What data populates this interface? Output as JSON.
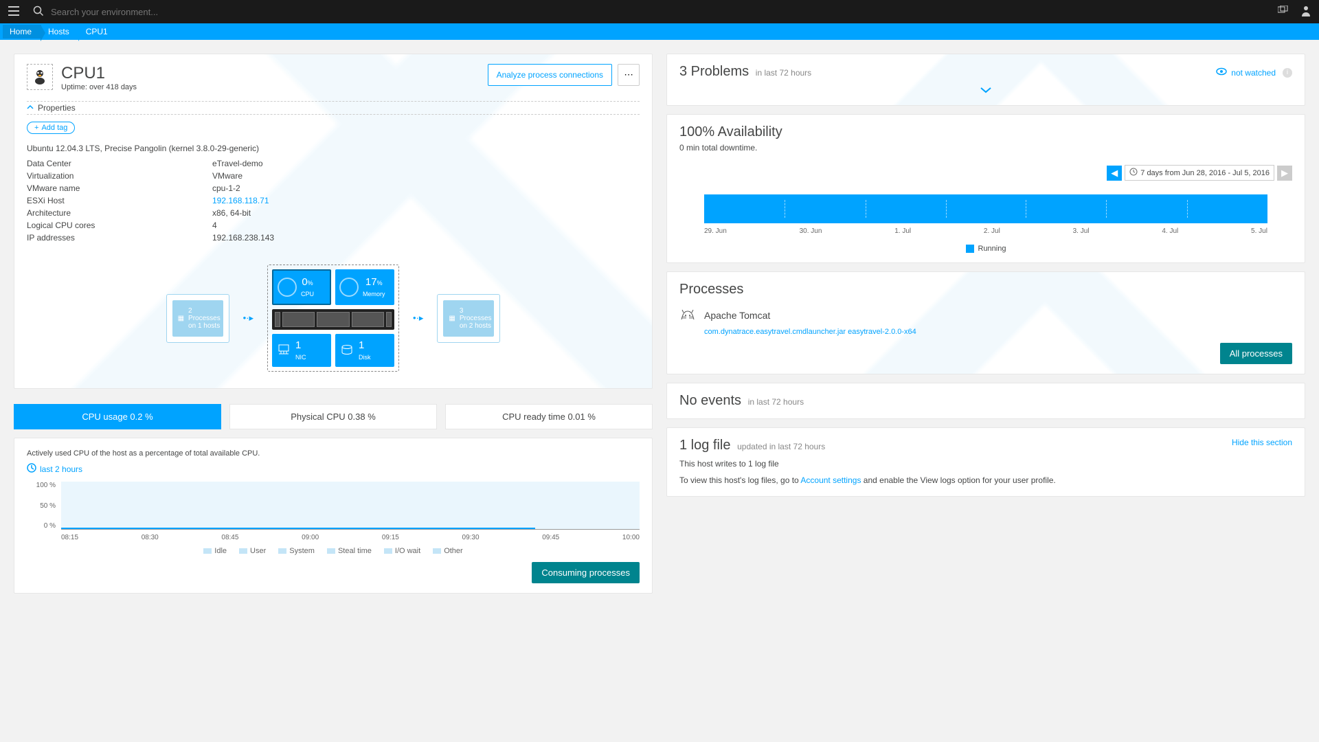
{
  "topbar": {
    "search_placeholder": "Search your environment..."
  },
  "breadcrumb": [
    "Home",
    "Hosts",
    "CPU1"
  ],
  "host": {
    "title": "CPU1",
    "uptime": "Uptime: over 418 days",
    "analyze_btn": "Analyze process connections",
    "properties_label": "Properties",
    "add_tag": "Add tag",
    "os": "Ubuntu 12.04.3 LTS, Precise Pangolin (kernel 3.8.0-29-generic)",
    "kv": [
      {
        "k": "Data Center",
        "v": "eTravel-demo"
      },
      {
        "k": "Virtualization",
        "v": "VMware"
      },
      {
        "k": "VMware name",
        "v": "cpu-1-2"
      },
      {
        "k": "ESXi Host",
        "v": "192.168.118.71",
        "link": true
      },
      {
        "k": "Architecture",
        "v": "x86, 64-bit"
      },
      {
        "k": "Logical CPU cores",
        "v": "4"
      },
      {
        "k": "IP addresses",
        "v": "192.168.238.143"
      }
    ],
    "smartscape": {
      "left": {
        "line1": "2 Processes",
        "line2": "on 1 hosts"
      },
      "cpu": {
        "val": "0",
        "unit": "%",
        "label": "CPU"
      },
      "mem": {
        "val": "17",
        "unit": "%",
        "label": "Memory"
      },
      "nic": {
        "val": "1",
        "label": "NIC"
      },
      "disk": {
        "val": "1",
        "label": "Disk"
      },
      "right": {
        "line1": "3 Processes",
        "line2": "on 2 hosts"
      }
    }
  },
  "tabs": [
    {
      "label": "CPU usage 0.2 %",
      "active": true
    },
    {
      "label": "Physical CPU 0.38 %"
    },
    {
      "label": "CPU ready time 0.01 %"
    }
  ],
  "tab_desc": "Actively used CPU of the host as a percentage of total available CPU.",
  "timerange": "last 2 hours",
  "chart_data": {
    "type": "area",
    "title": "",
    "ylabel": "%",
    "ylim": [
      0,
      100
    ],
    "yticks": [
      "100 %",
      "50 %",
      "0 %"
    ],
    "x": [
      "08:15",
      "08:30",
      "08:45",
      "09:00",
      "09:15",
      "09:30",
      "09:45",
      "10:00"
    ],
    "series": [
      {
        "name": "Idle",
        "values": [
          99.8,
          99.8,
          99.8,
          99.8,
          99.8,
          99.8,
          99.8,
          99.8
        ]
      },
      {
        "name": "User",
        "values": [
          0.1,
          0.1,
          0.1,
          0.1,
          0.1,
          0.1,
          0.1,
          0.1
        ]
      },
      {
        "name": "System",
        "values": [
          0.1,
          0.1,
          0.1,
          0.1,
          0.1,
          0.1,
          0.1,
          0.1
        ]
      },
      {
        "name": "Steal time",
        "values": [
          0,
          0,
          0,
          0,
          0,
          0,
          0,
          0
        ]
      },
      {
        "name": "I/O wait",
        "values": [
          0,
          0,
          0,
          0,
          0,
          0,
          0,
          0
        ]
      },
      {
        "name": "Other",
        "values": [
          0,
          0,
          0,
          0,
          0,
          0,
          0,
          0
        ]
      }
    ]
  },
  "consuming_btn": "Consuming processes",
  "problems": {
    "title": "3 Problems",
    "sub": "in last 72 hours",
    "watched": "not watched"
  },
  "availability": {
    "title": "100% Availability",
    "sub": "0 min total downtime.",
    "range": "7 days from Jun 28, 2016 - Jul 5, 2016",
    "xaxis": [
      "29. Jun",
      "30. Jun",
      "1. Jul",
      "2. Jul",
      "3. Jul",
      "4. Jul",
      "5. Jul"
    ],
    "legend": "Running"
  },
  "processes": {
    "title": "Processes",
    "name": "Apache Tomcat",
    "sub": "com.dynatrace.easytravel.cmdlauncher.jar easytravel-2.0.0-x64",
    "all_btn": "All processes"
  },
  "events": {
    "title": "No events",
    "sub": "in last 72 hours"
  },
  "logs": {
    "title": "1 log file",
    "sub": "updated in last 72 hours",
    "line1": "This host writes to 1 log file",
    "line2a": "To view this host's log files, go to ",
    "line2b": "Account settings",
    "line2c": " and enable the View logs option for your user profile.",
    "hide": "Hide this section"
  }
}
